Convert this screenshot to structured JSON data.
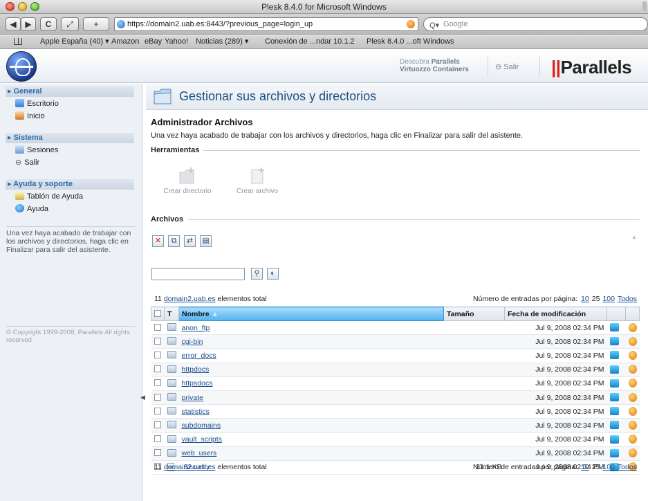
{
  "window": {
    "title": "Plesk 8.4.0 for Microsoft Windows"
  },
  "toolbar": {
    "url": "https://domain2.uab.es:8443/?previous_page=login_up",
    "search_placeholder": "Google",
    "back_label": "◀",
    "forward_label": "▶",
    "reload_label": "C",
    "snapback_label": "⤢",
    "add_label": "+"
  },
  "bookmarks": [
    "Apple España (40) ▾",
    "Amazon",
    "eBay",
    "Yahoo!",
    "Noticias (289) ▾",
    "Conexión de ...ndar 10.1.2",
    "Plesk 8.4.0 ...oft Windows"
  ],
  "header": {
    "promo_line1_prefix": "Descubra",
    "promo_line1_bold": "Parallels",
    "promo_line2": "Virtuozzo Containers",
    "logout_label": "Salir",
    "brand": "Parallels"
  },
  "sidebar": {
    "sections": [
      {
        "title": "General",
        "items": [
          "Escritorio",
          "Inicio"
        ]
      },
      {
        "title": "Sistema",
        "items": [
          "Sesiones",
          "Salir"
        ]
      },
      {
        "title": "Ayuda y soporte",
        "items": [
          "Tablón de Ayuda",
          "Ayuda"
        ]
      }
    ],
    "help_text": "Una vez haya acabado de trabajar con los archivos y directorios, haga clic en Finalizar para salir del asistente.",
    "copyright": "© Copyright 1999-2008, Parallels All rights reserved"
  },
  "main": {
    "page_title": "Gestionar sus archivos y directorios",
    "section_title": "Administrador Archivos",
    "section_desc": "Una vez haya acabado de trabajar con los archivos y directorios, haga clic en Finalizar para salir del asistente.",
    "tools_label": "Herramientas",
    "tools": [
      "Crear directorio",
      "Crear archivo"
    ],
    "files_label": "Archivos",
    "count_domain": "domain2.uab.es",
    "count_text": "11 domain2.uab.es elementos total",
    "count_prefix": "11",
    "count_suffix": "elementos total",
    "per_page_label": "Número de entradas por página:",
    "per_page_options": [
      "10",
      "25",
      "100",
      "Todos"
    ],
    "columns": {
      "type": "T",
      "name": "Nombre",
      "size": "Tamaño",
      "modified": "Fecha de modificación"
    },
    "files": [
      {
        "name": "anon_ftp",
        "kind": "folder",
        "size": "",
        "date": "Jul 9, 2008 02:34 PM"
      },
      {
        "name": "cgi-bin",
        "kind": "folder",
        "size": "",
        "date": "Jul 9, 2008 02:34 PM"
      },
      {
        "name": "error_docs",
        "kind": "folder",
        "size": "",
        "date": "Jul 9, 2008 02:34 PM"
      },
      {
        "name": "httpdocs",
        "kind": "folder",
        "size": "",
        "date": "Jul 9, 2008 02:34 PM"
      },
      {
        "name": "httpsdocs",
        "kind": "folder",
        "size": "",
        "date": "Jul 9, 2008 02:34 PM"
      },
      {
        "name": "private",
        "kind": "folder",
        "size": "",
        "date": "Jul 9, 2008 02:34 PM"
      },
      {
        "name": "statistics",
        "kind": "folder",
        "size": "",
        "date": "Jul 9, 2008 02:34 PM"
      },
      {
        "name": "subdomains",
        "kind": "folder",
        "size": "",
        "date": "Jul 9, 2008 02:34 PM"
      },
      {
        "name": "vault_scripts",
        "kind": "folder",
        "size": "",
        "date": "Jul 9, 2008 02:34 PM"
      },
      {
        "name": "web_users",
        "kind": "folder",
        "size": "",
        "date": "Jul 9, 2008 02:34 PM"
      },
      {
        "name": ".Security",
        "kind": "file",
        "size": "21.1 KB",
        "date": "Jul 9, 2008 02:34 PM"
      }
    ]
  }
}
